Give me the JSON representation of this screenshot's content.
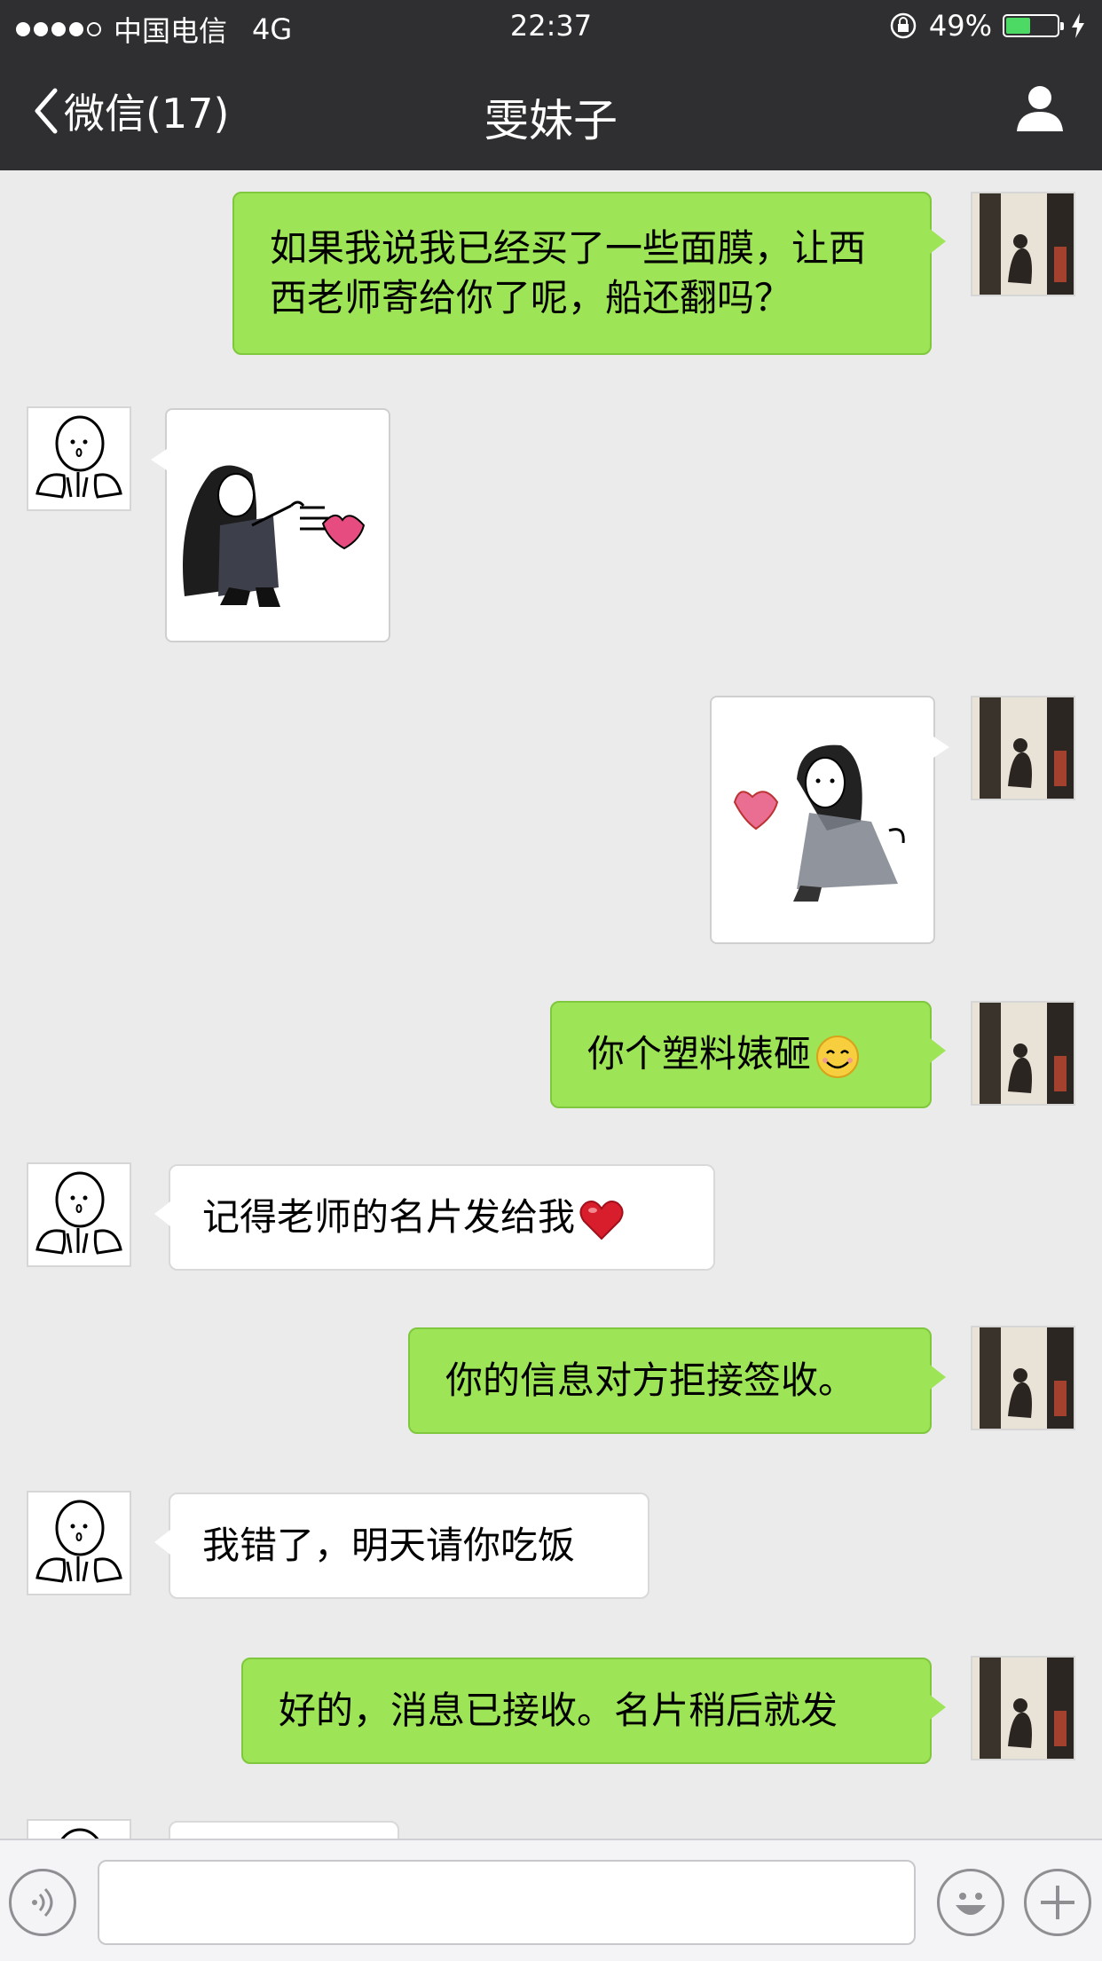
{
  "status_bar": {
    "carrier": "中国电信",
    "network": "4G",
    "time": "22:37",
    "battery": "49%",
    "battery_level": 0.49
  },
  "nav": {
    "back_label": "微信(17)",
    "title": "雯妹子"
  },
  "messages": [
    {
      "side": "out",
      "type": "text",
      "text": "如果我说我已经买了一些面膜，让西西老师寄给你了呢，船还翻吗？"
    },
    {
      "side": "in",
      "type": "sticker",
      "sticker": "girl-blowing-kiss-sticker"
    },
    {
      "side": "out",
      "type": "sticker",
      "sticker": "girl-holding-heart-sticker"
    },
    {
      "side": "out",
      "type": "text",
      "text": "你个塑料婊砸",
      "emoji": "smiley-emoji"
    },
    {
      "side": "in",
      "type": "text",
      "text": "记得老师的名片发给我",
      "emoji": "red-heart-emoji"
    },
    {
      "side": "out",
      "type": "text",
      "text": "你的信息对方拒接签收。"
    },
    {
      "side": "in",
      "type": "text",
      "text": "我错了，明天请你吃饭"
    },
    {
      "side": "out",
      "type": "text",
      "text": "好的，消息已接收。名片稍后就发"
    }
  ],
  "input": {
    "value": "",
    "voice_icon": "voice-icon",
    "emoji_icon": "emoji-icon",
    "plus_icon": "plus-icon"
  },
  "colors": {
    "bar_bg": "#2f2f31",
    "outgoing_bubble": "#9de556",
    "incoming_bubble": "#ffffff",
    "chat_bg": "#ebebeb"
  }
}
